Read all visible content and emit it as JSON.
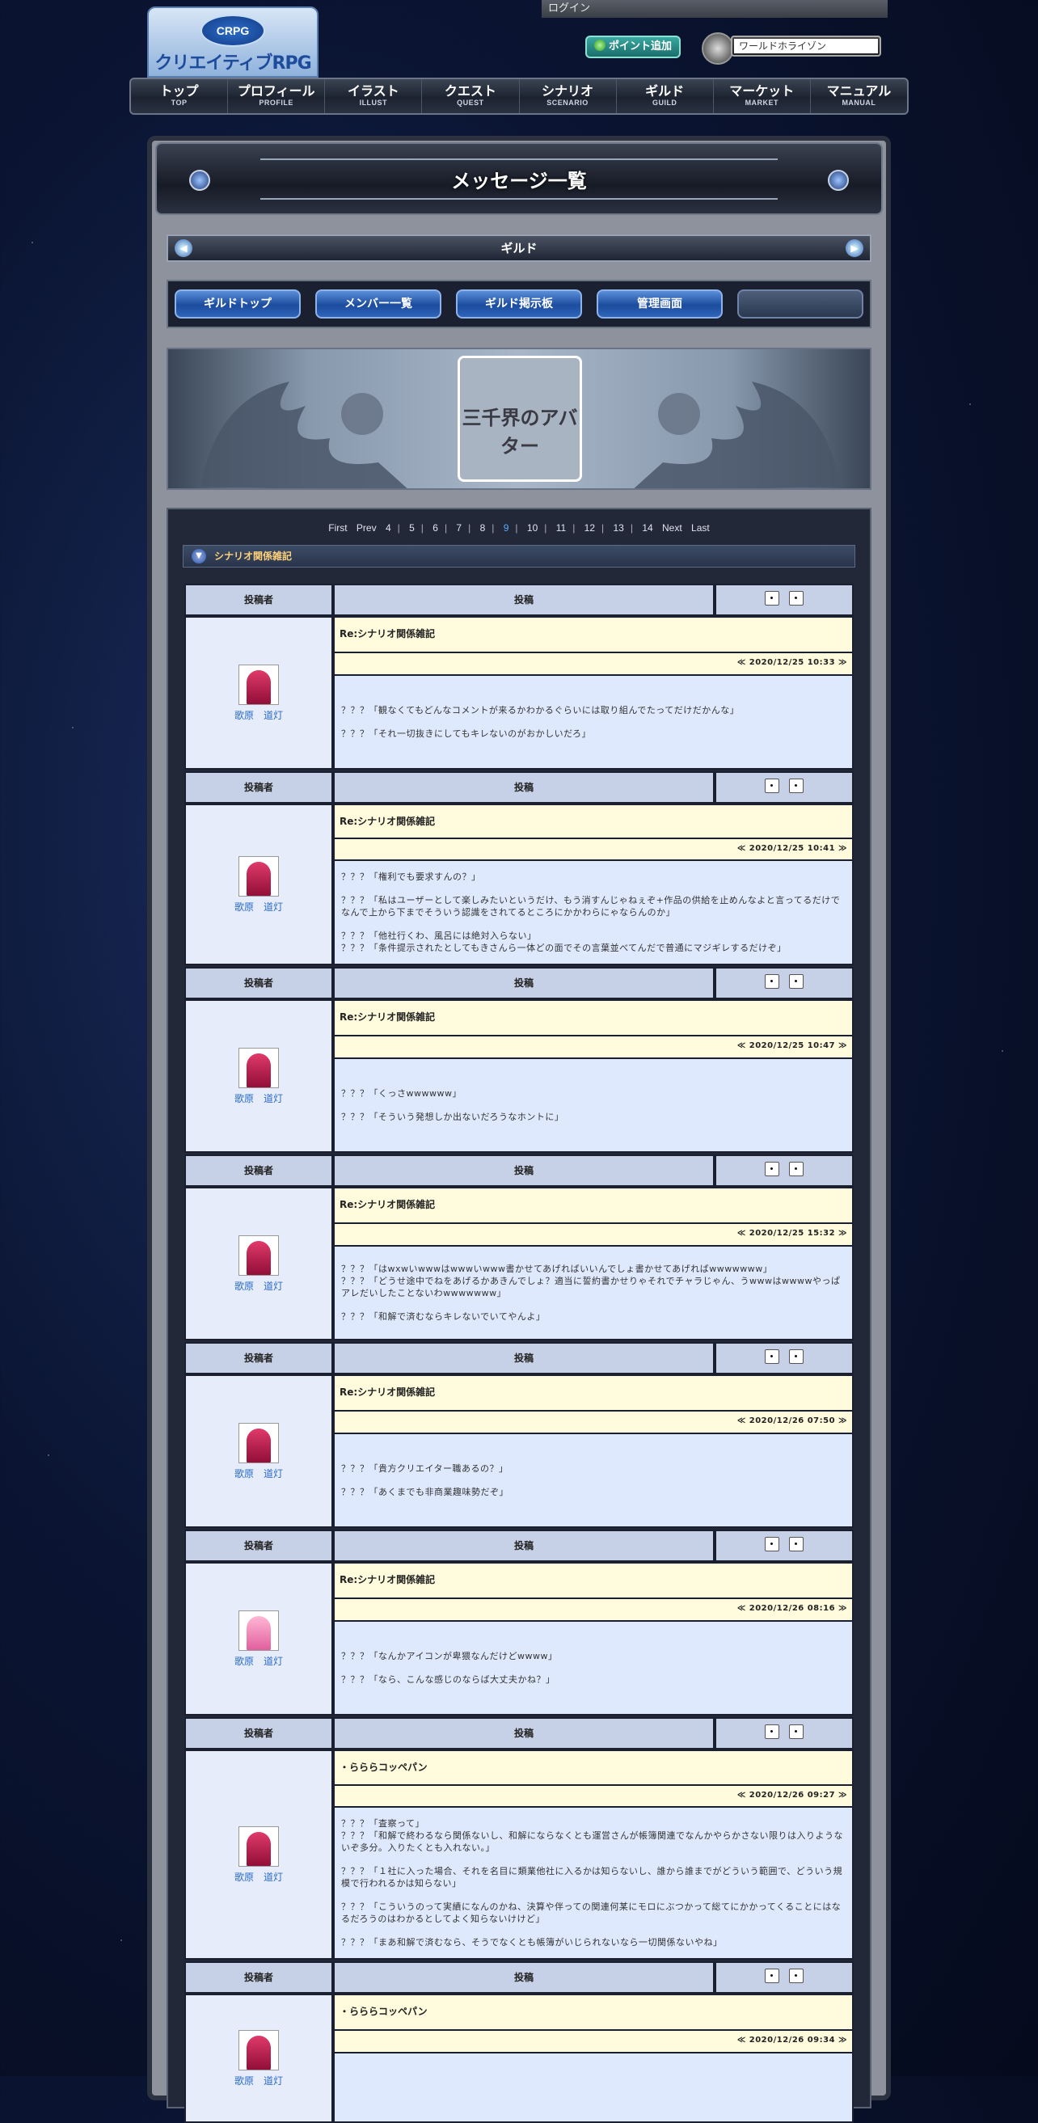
{
  "header": {
    "logo_badge": "CRPG",
    "logo_text": "クリエイティブRPG",
    "login": "ログイン",
    "point_button": "ポイント追加",
    "world": "ワールドホライゾン"
  },
  "nav": [
    {
      "jp": "トップ",
      "en": "TOP"
    },
    {
      "jp": "プロフィール",
      "en": "PROFILE"
    },
    {
      "jp": "イラスト",
      "en": "ILLUST"
    },
    {
      "jp": "クエスト",
      "en": "QUEST"
    },
    {
      "jp": "シナリオ",
      "en": "SCENARIO"
    },
    {
      "jp": "ギルド",
      "en": "GUILD"
    },
    {
      "jp": "マーケット",
      "en": "MARKET"
    },
    {
      "jp": "マニュアル",
      "en": "MANUAL"
    }
  ],
  "page_title": "メッセージ一覧",
  "section": "ギルド",
  "tabs": [
    "ギルドトップ",
    "メンバー一覧",
    "ギルド掲示板",
    "管理画面",
    ""
  ],
  "banner_title": "三千界のアバター",
  "pager": {
    "first": "First",
    "prev": "Prev",
    "next": "Next",
    "last": "Last",
    "pages": [
      "4",
      "5",
      "6",
      "7",
      "8",
      "9",
      "10",
      "11",
      "12",
      "13",
      "14"
    ],
    "current": "9"
  },
  "topic": "シナリオ関係雑記",
  "columns": {
    "author": "投稿者",
    "post": "投稿"
  },
  "posts": [
    {
      "author": "歌原　道灯",
      "subject": "Re:シナリオ関係雑記",
      "stamp": "≪ 2020/12/25 10:33 ≫",
      "lines": [
        "？？？「観なくてもどんなコメントが来るかわかるぐらいには取り組んでたってだけだかんな」",
        "？？？「それ一切抜きにしてもキレないのがおかしいだろ」"
      ]
    },
    {
      "author": "歌原　道灯",
      "subject": "Re:シナリオ関係雑記",
      "stamp": "≪ 2020/12/25 10:41 ≫",
      "lines": [
        "？？？「権利でも要求すんの？」",
        "？？？「私はユーザーとして楽しみたいというだけ、もう消すんじゃねぇぞ+作品の供給を止めんなよと言ってるだけでなんで上から下までそういう認識をされてるところにかかわらにゃならんのか」",
        "？？？「他社行くわ、風呂には絶対入らない」\n？？？「条件提示されたとしてもきさんら一体どの面でその言葉並べてんだで普通にマジギレするだけぞ」"
      ]
    },
    {
      "author": "歌原　道灯",
      "subject": "Re:シナリオ関係雑記",
      "stamp": "≪ 2020/12/25 10:47 ≫",
      "lines": [
        "？？？「くっさwwwwww」",
        "？？？「そういう発想しか出ないだろうなホントに」"
      ]
    },
    {
      "author": "歌原　道灯",
      "subject": "Re:シナリオ関係雑記",
      "stamp": "≪ 2020/12/25 15:32 ≫",
      "lines": [
        "？？？「はwxwいwwwはwwwいwww書かせてあげればいいんでしょ書かせてあげればwwwwwww」\n？？？「どうせ途中でねをあげるかあきんでしょ？適当に誓約書かせりゃそれでチャラじゃん、うwwwはwwwwやっぱアレだいしたことないわwwwwwww」",
        "？？？「和解で済むならキレないでいてやんよ」"
      ]
    },
    {
      "author": "歌原　道灯",
      "subject": "Re:シナリオ関係雑記",
      "stamp": "≪ 2020/12/26 07:50 ≫",
      "lines": [
        "？？？「貴方クリエイター職あるの？」",
        "？？？「あくまでも非商業趣味勢だぞ」"
      ]
    },
    {
      "author": "歌原　道灯",
      "subject": "Re:シナリオ関係雑記",
      "stamp": "≪ 2020/12/26 08:16 ≫",
      "lines": [
        "？？？「なんかアイコンが卑猥なんだけどwwww」",
        "？？？「なら、こんな感じのならば大丈夫かね？」"
      ]
    },
    {
      "author": "歌原　道灯",
      "subject": "・らららコッペパン",
      "stamp": "≪ 2020/12/26 09:27 ≫",
      "lines": [
        "？？？「査察って」\n？？？「和解で終わるなら関係ないし、和解にならなくとも運営さんが帳簿関連でなんかやらかさない限りは入りようないぞ多分。入りたくとも入れない。」",
        "？？？「１社に入った場合、それを名目に類業他社に入るかは知らないし、誰から誰までがどういう範囲で、どういう規模で行われるかは知らない」",
        "？？？「こういうのって実績になんのかね、決算や伴っての関連何某にモロにぶつかって総てにかかってくることにはなるだろうのはわかるとしてよく知らないけけど」",
        "？？？「まあ和解で済むなら、そうでなくとも帳簿がいじられないなら一切関係ないやね」"
      ]
    },
    {
      "author": "歌原　道灯",
      "subject": "・らららコッペパン",
      "stamp": "≪ 2020/12/26 09:34 ≫",
      "lines": []
    }
  ]
}
